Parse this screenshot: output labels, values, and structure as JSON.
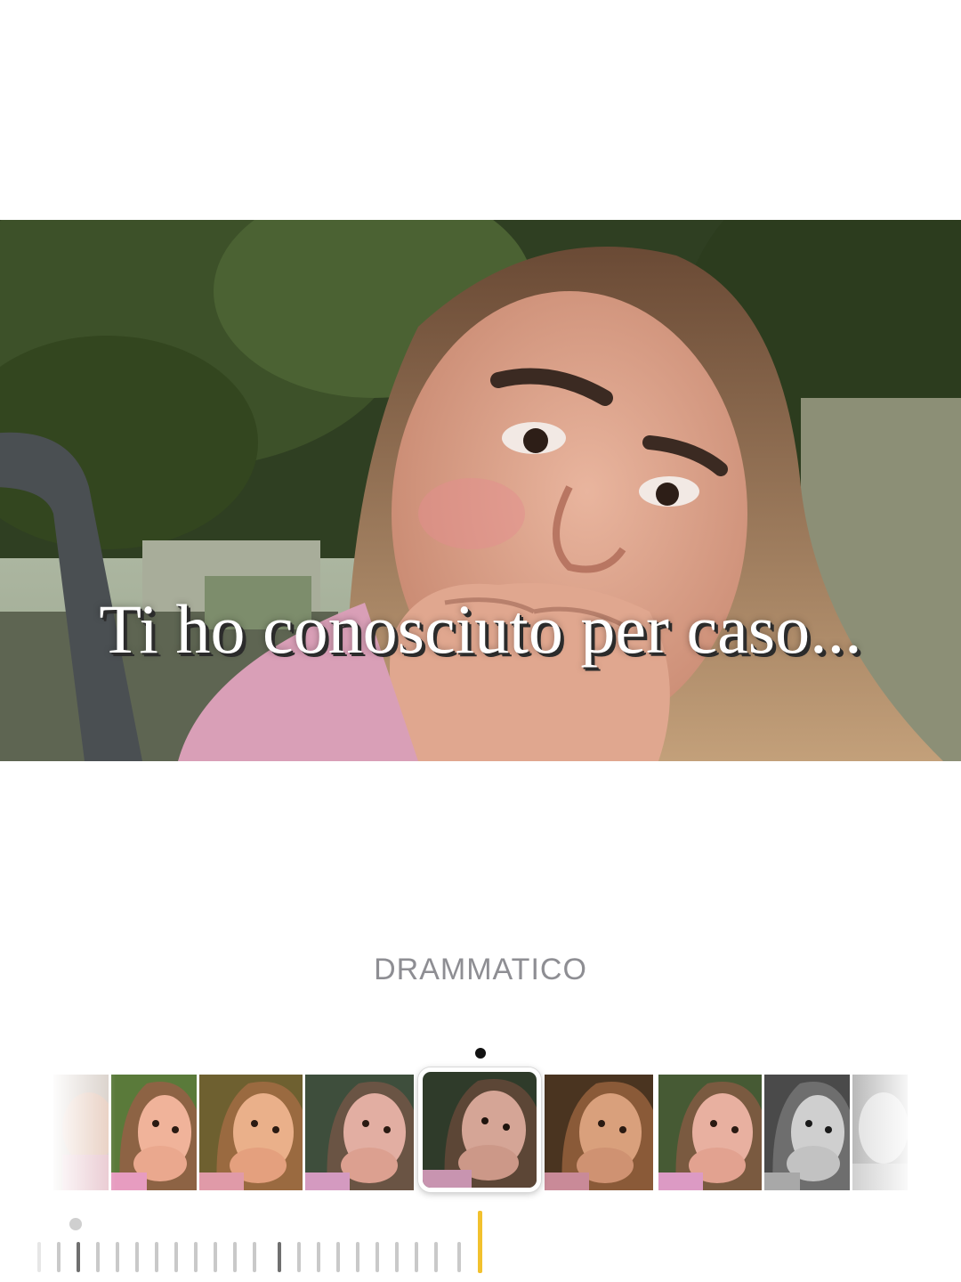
{
  "caption": "Ti ho conosciuto per caso...",
  "filter": {
    "selected_name": "DRAMMATICO",
    "selected_index": 4,
    "thumbnails": [
      {
        "tint": "faded"
      },
      {
        "tint": "vivid"
      },
      {
        "tint": "warm"
      },
      {
        "tint": "cool"
      },
      {
        "tint": "dramatic"
      },
      {
        "tint": "sepia"
      },
      {
        "tint": "natural"
      },
      {
        "tint": "mono"
      },
      {
        "tint": "silvertone"
      }
    ]
  },
  "intensity": {
    "value_fraction": 0.0,
    "active_color": "#f2c12e"
  },
  "colors": {
    "background": "#ffffff",
    "label": "#8e8e93",
    "accent": "#f2c12e"
  }
}
